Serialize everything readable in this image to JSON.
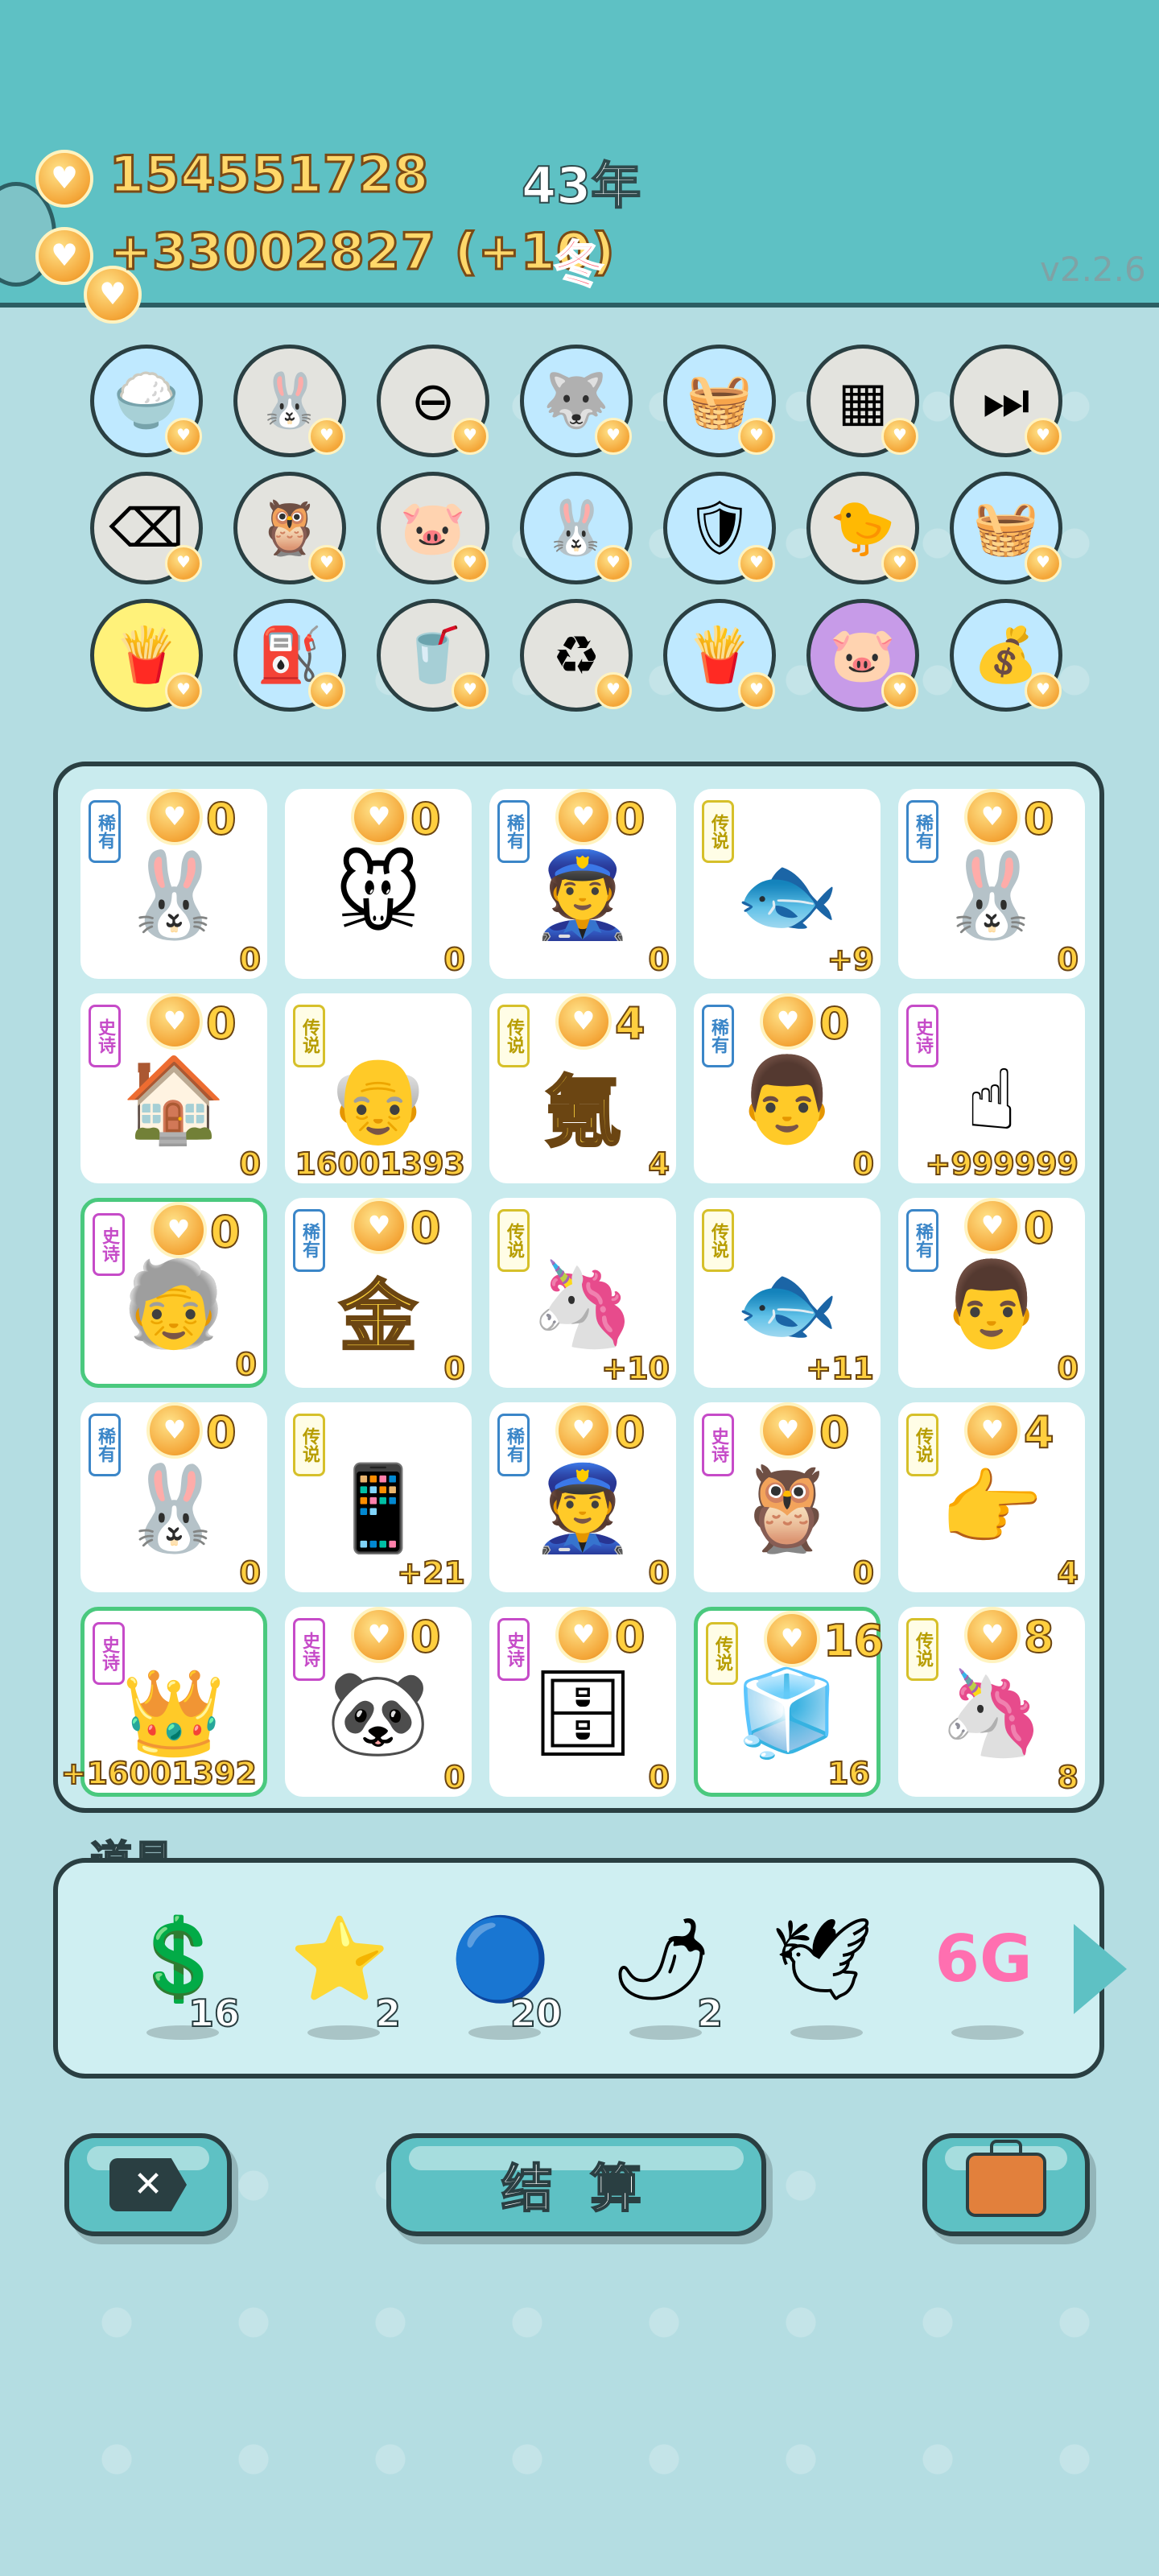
{
  "header": {
    "money": "154551728",
    "income": "+33002827 (+10)",
    "year": "43年",
    "season": "冬",
    "version": "v2.2.6"
  },
  "tools": [
    {
      "icon": "rice-bowl-icon",
      "glyph": "🍚",
      "bg": "#bfe9ff"
    },
    {
      "icon": "rabbit-icon",
      "glyph": "🐰",
      "bg": "#e3e3de"
    },
    {
      "icon": "remove-icon",
      "glyph": "⊖",
      "bg": "#e3e3de"
    },
    {
      "icon": "husky-icon",
      "glyph": "🐺",
      "bg": "#bfe9ff"
    },
    {
      "icon": "fruit-basket-icon",
      "glyph": "🧺",
      "bg": "#bfe9ff"
    },
    {
      "icon": "blocks-icon",
      "glyph": "▦",
      "bg": "#e3e3de"
    },
    {
      "icon": "skip-icon",
      "glyph": "⏭",
      "bg": "#e3e3de"
    },
    {
      "icon": "delete-tag-icon",
      "glyph": "⌫",
      "bg": "#e3e3de"
    },
    {
      "icon": "owl-icon",
      "glyph": "🦉",
      "bg": "#e3e3de"
    },
    {
      "icon": "twin-pigs-icon",
      "glyph": "🐷",
      "bg": "#e3e3de"
    },
    {
      "icon": "rabbit-icon",
      "glyph": "🐰",
      "bg": "#bfe9ff"
    },
    {
      "icon": "shield-wrench-icon",
      "glyph": "🛡",
      "bg": "#bfe9ff"
    },
    {
      "icon": "chick-egg-icon",
      "glyph": "🐤",
      "bg": "#e3e3de"
    },
    {
      "icon": "fruit-basket-icon",
      "glyph": "🧺",
      "bg": "#bfe9ff"
    },
    {
      "icon": "fries-icon",
      "glyph": "🍟",
      "bg": "#fff27a"
    },
    {
      "icon": "pump-icon",
      "glyph": "⛽",
      "bg": "#bfe9ff"
    },
    {
      "icon": "bubble-tea-icon",
      "glyph": "🥤",
      "bg": "#e3e3de"
    },
    {
      "icon": "recycle-icon",
      "glyph": "♻",
      "bg": "#e3e3de"
    },
    {
      "icon": "fries-icon",
      "glyph": "🍟",
      "bg": "#bfe9ff"
    },
    {
      "icon": "twin-pigs-icon",
      "glyph": "🐷",
      "bg": "#c79be8"
    },
    {
      "icon": "sack-icon",
      "glyph": "💰",
      "bg": "#bfe9ff"
    }
  ],
  "cards": [
    {
      "tag": "稀有",
      "tagType": "rare",
      "top": "0",
      "bottom": "0",
      "icon": "rabbit-icon",
      "glyph": "🐰",
      "hl": false
    },
    {
      "tag": "",
      "tagType": "",
      "top": "0",
      "bottom": "0",
      "icon": "mouse-icon",
      "glyph": "🐭",
      "hl": false
    },
    {
      "tag": "稀有",
      "tagType": "rare",
      "top": "0",
      "bottom": "0",
      "icon": "police-icon",
      "glyph": "👮",
      "hl": false
    },
    {
      "tag": "传说",
      "tagType": "legend",
      "top": "",
      "bottom": "+9",
      "icon": "koi-fish-icon",
      "glyph": "🐟",
      "hl": false
    },
    {
      "tag": "稀有",
      "tagType": "rare",
      "top": "0",
      "bottom": "0",
      "icon": "rabbit-icon",
      "glyph": "🐰",
      "hl": false
    },
    {
      "tag": "史诗",
      "tagType": "epic",
      "top": "0",
      "bottom": "0",
      "icon": "rabbit-house-icon",
      "glyph": "🏠",
      "hl": false
    },
    {
      "tag": "传说",
      "tagType": "legend",
      "top": "",
      "bottom": "16001393",
      "icon": "old-man-glasses-icon",
      "glyph": "👴",
      "hl": false
    },
    {
      "tag": "传说",
      "tagType": "legend",
      "top": "4",
      "bottom": "4",
      "icon": "krypton-char-icon",
      "glyph": "",
      "big": "氪",
      "hl": false
    },
    {
      "tag": "稀有",
      "tagType": "rare",
      "top": "0",
      "bottom": "0",
      "icon": "bald-man-icon",
      "glyph": "👨",
      "hl": false
    },
    {
      "tag": "史诗",
      "tagType": "epic",
      "top": "",
      "bottom": "+999999",
      "icon": "pointing-hand-icon",
      "glyph": "☝",
      "hl": false
    },
    {
      "tag": "史诗",
      "tagType": "epic",
      "top": "0",
      "bottom": "0",
      "icon": "old-man-hat-icon",
      "glyph": "🧓",
      "hl": true
    },
    {
      "tag": "稀有",
      "tagType": "rare",
      "top": "0",
      "bottom": "0",
      "icon": "gold-badge-icon",
      "glyph": "",
      "big": "金",
      "hl": false
    },
    {
      "tag": "传说",
      "tagType": "legend",
      "top": "",
      "bottom": "+10",
      "icon": "unicorn-icon",
      "glyph": "🦄",
      "hl": false
    },
    {
      "tag": "传说",
      "tagType": "legend",
      "top": "",
      "bottom": "+11",
      "icon": "koi-fish-icon",
      "glyph": "🐟",
      "hl": false
    },
    {
      "tag": "稀有",
      "tagType": "rare",
      "top": "0",
      "bottom": "0",
      "icon": "bald-man-icon",
      "glyph": "👨",
      "hl": false
    },
    {
      "tag": "稀有",
      "tagType": "rare",
      "top": "0",
      "bottom": "0",
      "icon": "rabbit-icon",
      "glyph": "🐰",
      "hl": false
    },
    {
      "tag": "传说",
      "tagType": "legend",
      "top": "",
      "bottom": "+21",
      "icon": "phone-icon",
      "glyph": "📱",
      "hl": false
    },
    {
      "tag": "稀有",
      "tagType": "rare",
      "top": "0",
      "bottom": "0",
      "icon": "police-icon",
      "glyph": "👮",
      "hl": false
    },
    {
      "tag": "史诗",
      "tagType": "epic",
      "top": "0",
      "bottom": "0",
      "icon": "owl-icon",
      "glyph": "🦉",
      "hl": false
    },
    {
      "tag": "传说",
      "tagType": "legend",
      "top": "4",
      "bottom": "4",
      "icon": "pointing-hand-icon",
      "glyph": "👉",
      "hl": false
    },
    {
      "tag": "史诗",
      "tagType": "epic",
      "top": "",
      "bottom": "+16001392",
      "icon": "king-old-man-icon",
      "glyph": "👑",
      "hl": true
    },
    {
      "tag": "史诗",
      "tagType": "epic",
      "top": "0",
      "bottom": "0",
      "icon": "panda-icon",
      "glyph": "🐼",
      "hl": false
    },
    {
      "tag": "史诗",
      "tagType": "epic",
      "top": "0",
      "bottom": "0",
      "icon": "server-icon",
      "glyph": "🗄",
      "hl": false
    },
    {
      "tag": "传说",
      "tagType": "legend",
      "top": "16",
      "bottom": "16",
      "icon": "fridge-icon",
      "glyph": "🧊",
      "hl": true
    },
    {
      "tag": "传说",
      "tagType": "legend",
      "top": "8",
      "bottom": "8",
      "icon": "unicorn-icon",
      "glyph": "🦄",
      "hl": false
    }
  ],
  "items": {
    "label": "道具",
    "list": [
      {
        "icon": "dollar-coin-icon",
        "glyph": "💲",
        "count": "16"
      },
      {
        "icon": "star-icon",
        "glyph": "⭐",
        "count": "2"
      },
      {
        "icon": "blueberry-icon",
        "glyph": "🔵",
        "count": "20"
      },
      {
        "icon": "chili-pepper-icon",
        "glyph": "🌶",
        "count": "2"
      },
      {
        "icon": "duck-icon",
        "glyph": "🕊",
        "count": ""
      },
      {
        "icon": "6g-icon",
        "glyph": "6G",
        "count": ""
      }
    ]
  },
  "buttons": {
    "settle": "结 算"
  }
}
